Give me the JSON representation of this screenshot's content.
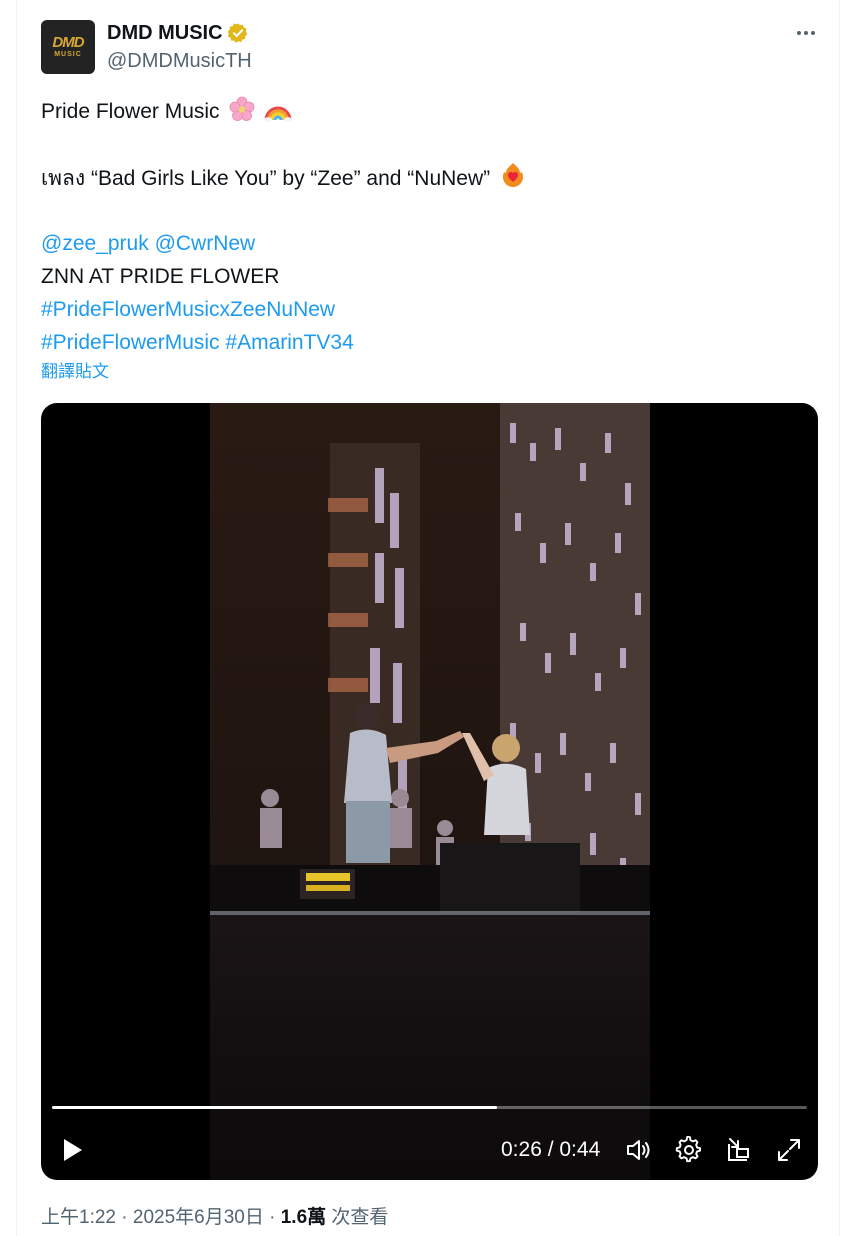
{
  "author": {
    "display_name": "DMD MUSIC",
    "handle": "@DMDMusicTH",
    "avatar_text": "DMD",
    "avatar_subtext": "MUSIC",
    "verified_icon": "gold-verified-badge-icon"
  },
  "post": {
    "line1": "Pride Flower Music",
    "line2": "เพลง “Bad Girls Like You” by “Zee” and “NuNew”",
    "mention1": "@zee_pruk",
    "mention2": "@CwrNew",
    "line4": "ZNN AT PRIDE FLOWER",
    "hashtag1": "#PrideFlowerMusicxZeeNuNew",
    "hashtag2": "#PrideFlowerMusic",
    "hashtag3": "#AmarinTV34",
    "translate_link": "翻譯貼文"
  },
  "video": {
    "current_time": "0:26",
    "duration": "0:44",
    "time_display": "0:26 / 0:44",
    "progress_fraction": 0.59
  },
  "meta": {
    "time": "上午1:22",
    "separator": " · ",
    "date": "2025年6月30日",
    "views_count": "1.6萬",
    "views_label": " 次查看"
  },
  "colors": {
    "link": "#1d9bf0",
    "secondary_text": "#536471",
    "verified_gold": "#e2b719"
  }
}
